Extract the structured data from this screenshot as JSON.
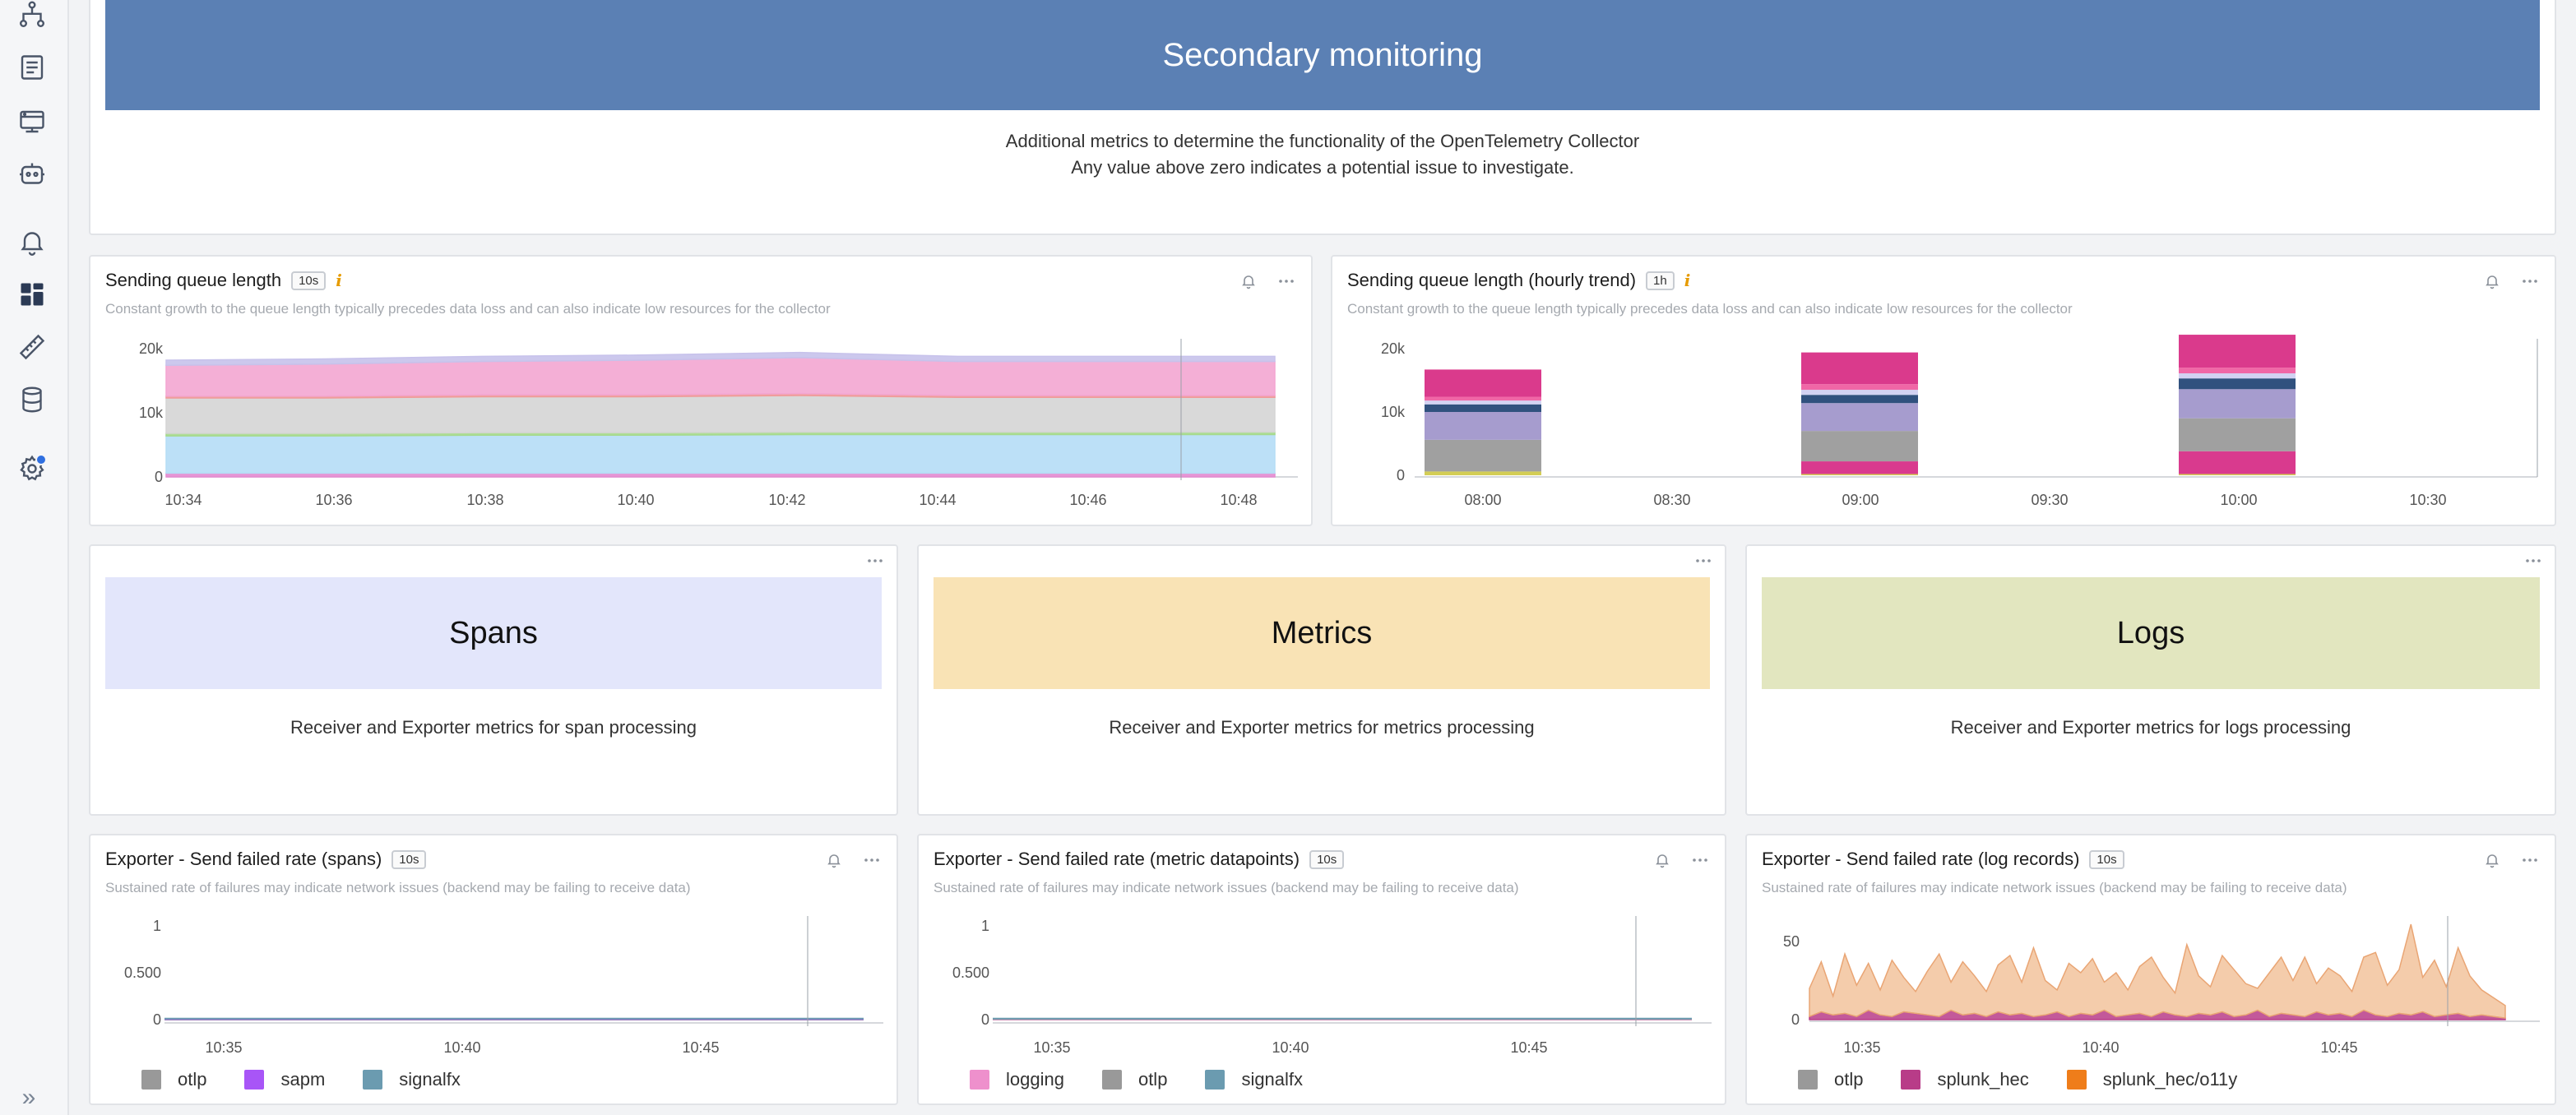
{
  "sidebar": {
    "icons": [
      {
        "name": "topology-icon"
      },
      {
        "name": "log-list-icon"
      },
      {
        "name": "infrastructure-icon"
      },
      {
        "name": "robot-icon"
      },
      {
        "name": "alerts-bell-icon"
      },
      {
        "name": "dashboards-icon",
        "active": true
      },
      {
        "name": "ruler-icon"
      },
      {
        "name": "database-icon"
      },
      {
        "name": "settings-gear-icon",
        "badge": true
      }
    ],
    "collapse_glyph": "»"
  },
  "header": {
    "title": "Secondary monitoring",
    "description_line1": "Additional metrics to determine the functionality of the OpenTelemetry Collector",
    "description_line2": "Any value above zero indicates a potential issue to investigate.",
    "banner_color": "#5b80b4"
  },
  "charts": {
    "queue": {
      "title": "Sending queue length",
      "resolution": "10s",
      "info": "i",
      "subtitle": "Constant growth to the queue length typically precedes data loss and can also indicate low resources for the collector"
    },
    "queue_hourly": {
      "title": "Sending queue length (hourly trend)",
      "resolution": "1h",
      "info": "i",
      "subtitle": "Constant growth to the queue length typically precedes data loss and can also indicate low resources for the collector"
    },
    "failed_spans": {
      "title": "Exporter - Send failed rate (spans)",
      "resolution": "10s",
      "subtitle": "Sustained rate of failures may indicate network issues (backend may be failing to receive data)",
      "legend": [
        {
          "label": "otlp",
          "color": "#999999"
        },
        {
          "label": "sapm",
          "color": "#a855f7"
        },
        {
          "label": "signalfx",
          "color": "#6b9bb0"
        }
      ]
    },
    "failed_metrics": {
      "title": "Exporter - Send failed rate (metric datapoints)",
      "resolution": "10s",
      "subtitle": "Sustained rate of failures may indicate network issues (backend may be failing to receive data)",
      "legend": [
        {
          "label": "logging",
          "color": "#ee90cc"
        },
        {
          "label": "otlp",
          "color": "#999999"
        },
        {
          "label": "signalfx",
          "color": "#6b9bb0"
        }
      ]
    },
    "failed_logs": {
      "title": "Exporter - Send failed rate (log records)",
      "resolution": "10s",
      "subtitle": "Sustained rate of failures may indicate network issues (backend may be failing to receive data)",
      "legend": [
        {
          "label": "otlp",
          "color": "#999999"
        },
        {
          "label": "splunk_hec",
          "color": "#b83c88"
        },
        {
          "label": "splunk_hec/o11y",
          "color": "#ef7d1a"
        }
      ]
    }
  },
  "categories": [
    {
      "key": "spans",
      "title": "Spans",
      "description": "Receiver and Exporter metrics for span processing",
      "color": "#e3e6fb"
    },
    {
      "key": "metrics",
      "title": "Metrics",
      "description": "Receiver and Exporter metrics for metrics processing",
      "color": "#f9e3b5"
    },
    {
      "key": "logs",
      "title": "Logs",
      "description": "Receiver and Exporter metrics for logs processing",
      "color": "#e2e6bf"
    }
  ],
  "chart_data": [
    {
      "id": "queue",
      "type": "area",
      "title": "Sending queue length",
      "x": [
        "10:34",
        "10:36",
        "10:38",
        "10:40",
        "10:42",
        "10:44",
        "10:46",
        "10:48"
      ],
      "y_ticks": [
        "0",
        "10k",
        "20k"
      ],
      "ylim": [
        0,
        20000
      ],
      "series": [
        {
          "color": "#e38bd0",
          "values": [
            600,
            600,
            600,
            600,
            600,
            600,
            600,
            600
          ]
        },
        {
          "color": "#b5ddf6",
          "values": [
            5800,
            5800,
            5900,
            5900,
            6000,
            6000,
            6000,
            6000
          ]
        },
        {
          "color": "#a6d98c",
          "values": [
            400,
            400,
            400,
            400,
            400,
            400,
            400,
            400
          ]
        },
        {
          "color": "#d5d5d5",
          "values": [
            5500,
            5500,
            5600,
            5600,
            5700,
            5400,
            5400,
            5400
          ]
        },
        {
          "color": "#f09a9a",
          "values": [
            300,
            300,
            300,
            300,
            300,
            300,
            300,
            300
          ]
        },
        {
          "color": "#f3a6d2",
          "values": [
            4800,
            5000,
            5200,
            5400,
            5600,
            5300,
            5300,
            5300
          ]
        },
        {
          "color": "#c7c2eb",
          "values": [
            800,
            800,
            800,
            800,
            800,
            800,
            800,
            800
          ]
        }
      ]
    },
    {
      "id": "queue_hourly",
      "type": "bar",
      "title": "Sending queue length (hourly trend)",
      "x_ticks": [
        "08:00",
        "08:30",
        "09:00",
        "09:30",
        "10:00",
        "10:30"
      ],
      "y_ticks": [
        "0",
        "10k",
        "20k"
      ],
      "ylim": [
        0,
        20000
      ],
      "categories": [
        "08:00",
        "09:00",
        "10:00"
      ],
      "series": [
        {
          "color": "#d3cd55",
          "values": [
            600,
            200,
            200
          ]
        },
        {
          "color": "#d93a8e",
          "values": [
            0,
            2000,
            3600
          ]
        },
        {
          "color": "#a0a0a0",
          "values": [
            5000,
            4800,
            5200
          ]
        },
        {
          "color": "#a69cce",
          "values": [
            4400,
            4400,
            4600
          ]
        },
        {
          "color": "#30517e",
          "values": [
            1200,
            1300,
            1700
          ]
        },
        {
          "color": "#d2d2f2",
          "values": [
            600,
            800,
            800
          ]
        },
        {
          "color": "#f067a6",
          "values": [
            600,
            900,
            900
          ]
        },
        {
          "color": "#da3a8c",
          "values": [
            4300,
            5000,
            5200
          ]
        }
      ]
    },
    {
      "id": "failed_spans",
      "type": "line",
      "title": "Exporter - Send failed rate (spans)",
      "x_ticks": [
        "10:35",
        "10:40",
        "10:45"
      ],
      "y_ticks": [
        "0",
        "0.500",
        "1"
      ],
      "ylim": [
        0,
        1
      ],
      "series": [
        {
          "name": "otlp",
          "values": [
            0,
            0,
            0,
            0,
            0,
            0,
            0,
            0,
            0,
            0,
            0,
            0,
            0,
            0,
            0
          ]
        },
        {
          "name": "sapm",
          "values": [
            0,
            0,
            0,
            0,
            0,
            0,
            0,
            0,
            0,
            0,
            0,
            0,
            0,
            0,
            0
          ]
        },
        {
          "name": "signalfx",
          "values": [
            0,
            0,
            0,
            0,
            0,
            0,
            0,
            0,
            0,
            0,
            0,
            0,
            0,
            0,
            0
          ]
        }
      ]
    },
    {
      "id": "failed_metrics",
      "type": "line",
      "title": "Exporter - Send failed rate (metric datapoints)",
      "x_ticks": [
        "10:35",
        "10:40",
        "10:45"
      ],
      "y_ticks": [
        "0",
        "0.500",
        "1"
      ],
      "ylim": [
        0,
        1
      ],
      "series": [
        {
          "name": "logging",
          "values": [
            0,
            0,
            0,
            0,
            0,
            0,
            0,
            0,
            0,
            0,
            0,
            0,
            0,
            0,
            0
          ]
        },
        {
          "name": "otlp",
          "values": [
            0,
            0,
            0,
            0,
            0,
            0,
            0,
            0,
            0,
            0,
            0,
            0,
            0,
            0,
            0
          ]
        },
        {
          "name": "signalfx",
          "values": [
            0,
            0,
            0,
            0,
            0,
            0,
            0,
            0,
            0,
            0,
            0,
            0,
            0,
            0,
            0
          ]
        }
      ]
    },
    {
      "id": "failed_logs",
      "type": "area",
      "title": "Exporter - Send failed rate (log records)",
      "x_ticks": [
        "10:35",
        "10:40",
        "10:45"
      ],
      "y_ticks": [
        "0",
        "50"
      ],
      "ylim": [
        0,
        60
      ],
      "series": [
        {
          "name": "splunk_hec",
          "color": "#b83c88",
          "values": [
            2,
            5,
            3,
            4,
            2,
            6,
            3,
            2,
            5,
            4,
            3,
            2,
            6,
            3,
            4,
            2,
            5,
            3,
            4,
            2,
            3,
            5,
            2,
            4,
            3,
            6,
            2,
            3,
            4,
            2,
            5,
            3,
            2,
            4,
            3,
            5,
            2,
            3,
            6,
            2,
            4,
            3,
            2,
            5,
            3,
            4,
            2,
            6,
            3,
            2,
            4,
            3,
            5,
            2,
            3,
            4,
            2,
            3,
            2,
            1
          ]
        },
        {
          "name": "splunk_hec/o11y",
          "color": "#f2c39c",
          "values": [
            18,
            32,
            12,
            38,
            20,
            30,
            16,
            36,
            22,
            14,
            28,
            40,
            18,
            34,
            24,
            16,
            30,
            38,
            20,
            44,
            22,
            14,
            34,
            26,
            36,
            18,
            28,
            16,
            30,
            38,
            22,
            14,
            46,
            24,
            18,
            36,
            30,
            20,
            14,
            28,
            36,
            22,
            38,
            18,
            30,
            24,
            16,
            34,
            40,
            20,
            28,
            58,
            22,
            36,
            18,
            42,
            26,
            16,
            12,
            8
          ]
        }
      ]
    }
  ]
}
